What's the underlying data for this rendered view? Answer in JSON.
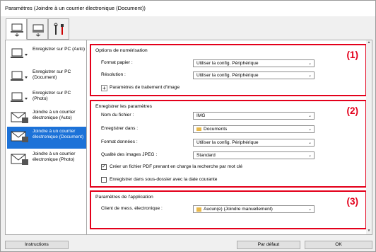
{
  "window": {
    "title": "Paramètres (Joindre à un courrier électronique (Document))"
  },
  "tabs": [
    {
      "name": "scan-from-computer",
      "icon": "computer-scan-icon"
    },
    {
      "name": "scan-from-panel",
      "icon": "scanner-icon"
    },
    {
      "name": "general-settings",
      "icon": "tools-icon"
    }
  ],
  "sidebar": {
    "items": [
      {
        "label": "Enregistrer sur PC (Auto)",
        "icon": "save-pc-icon",
        "selected": false
      },
      {
        "label": "Enregistrer sur PC (Document)",
        "icon": "save-pc-icon",
        "selected": false
      },
      {
        "label": "Enregistrer sur PC (Photo)",
        "icon": "save-pc-icon",
        "selected": false
      },
      {
        "label": "Joindre à un courrier électronique (Auto)",
        "icon": "email-icon",
        "selected": false
      },
      {
        "label": "Joindre à un courrier électronique (Document)",
        "icon": "email-icon",
        "selected": true
      },
      {
        "label": "Joindre à un courrier électronique (Photo)",
        "icon": "email-icon",
        "selected": false
      }
    ]
  },
  "scan_options": {
    "heading": "Options de numérisation",
    "marker": "(1)",
    "paper_label": "Format papier :",
    "paper_value": "Utiliser la config. Périphérique",
    "resolution_label": "Résolution :",
    "resolution_value": "Utiliser la config. Périphérique",
    "image_processing_label": "Paramètres de traitement d'image"
  },
  "save_settings": {
    "heading": "Enregistrer les paramètres",
    "marker": "(2)",
    "filename_label": "Nom du fichier :",
    "filename_value": "IMG",
    "save_in_label": "Enregistrer dans :",
    "save_in_value": "Documents",
    "format_label": "Format données :",
    "format_value": "Utiliser la config. Périphérique",
    "jpeg_label": "Qualité des images JPEG :",
    "jpeg_value": "Standard",
    "searchable_pdf_label": "Créer un fichier PDF prenant en charge la recherche par mot clé",
    "searchable_pdf_checked": true,
    "subfolder_label": "Enregistrer dans sous-dossier avec la date courante",
    "subfolder_checked": false
  },
  "app_settings": {
    "heading": "Paramètres de l'application",
    "marker": "(3)",
    "client_label": "Client de mess. électronique :",
    "client_value": "Aucun(e) (Joindre manuellement)"
  },
  "footer": {
    "instructions": "Instructions",
    "defaults": "Par défaut",
    "ok": "OK"
  },
  "colors": {
    "accent_red": "#e3001b",
    "selection_blue": "#1c72d8"
  }
}
